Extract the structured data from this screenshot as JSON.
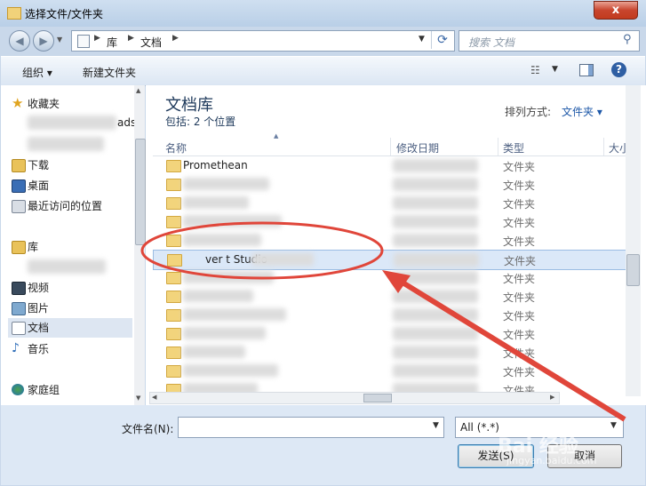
{
  "window": {
    "title": "选择文件/文件夹",
    "close": "x"
  },
  "address": {
    "path": [
      "库",
      "文档"
    ]
  },
  "search": {
    "placeholder": "搜索 文档"
  },
  "toolbar": {
    "organize": "组织 ▾",
    "new_folder": "新建文件夹",
    "help": "?"
  },
  "nav": {
    "favorites": "收藏夹",
    "downloads": "下载",
    "desktop": "桌面",
    "recent": "最近访问的位置",
    "partial": "ads",
    "libraries": "库",
    "videos": "视频",
    "pictures": "图片",
    "documents": "文档",
    "music": "音乐",
    "homegroup": "家庭组"
  },
  "main": {
    "title": "文档库",
    "subtitle": "包括: 2 个位置",
    "arrange_label": "排列方式:",
    "arrange_value": "文件夹 ▾"
  },
  "columns": {
    "name": "名称",
    "date": "修改日期",
    "type": "类型",
    "size": "大小"
  },
  "rows": [
    {
      "name": "Promethean",
      "type": "文件夹"
    },
    {
      "name": "",
      "type": "文件夹"
    },
    {
      "name": "",
      "type": "文件夹"
    },
    {
      "name": "",
      "type": "文件夹"
    },
    {
      "name": "",
      "type": "文件夹"
    },
    {
      "name": "ver                 t Studio",
      "type": "文件夹"
    },
    {
      "name": "",
      "type": "文件夹"
    },
    {
      "name": "",
      "type": "文件夹"
    },
    {
      "name": "",
      "type": "文件夹"
    },
    {
      "name": "",
      "type": "文件夹"
    },
    {
      "name": "",
      "type": "文件夹"
    },
    {
      "name": "",
      "type": "文件夹"
    },
    {
      "name": "",
      "type": "文件夹"
    }
  ],
  "bottom": {
    "filename_label": "文件名(N):",
    "filename_value": "",
    "filter": "All (*.*)",
    "send": "发送(S)",
    "cancel": "取消"
  },
  "watermark": "Bai 经验",
  "watermark_url": "jingyan.baidu.com",
  "colors": {
    "annotation": "#e0463a",
    "accent": "#1e395b"
  }
}
